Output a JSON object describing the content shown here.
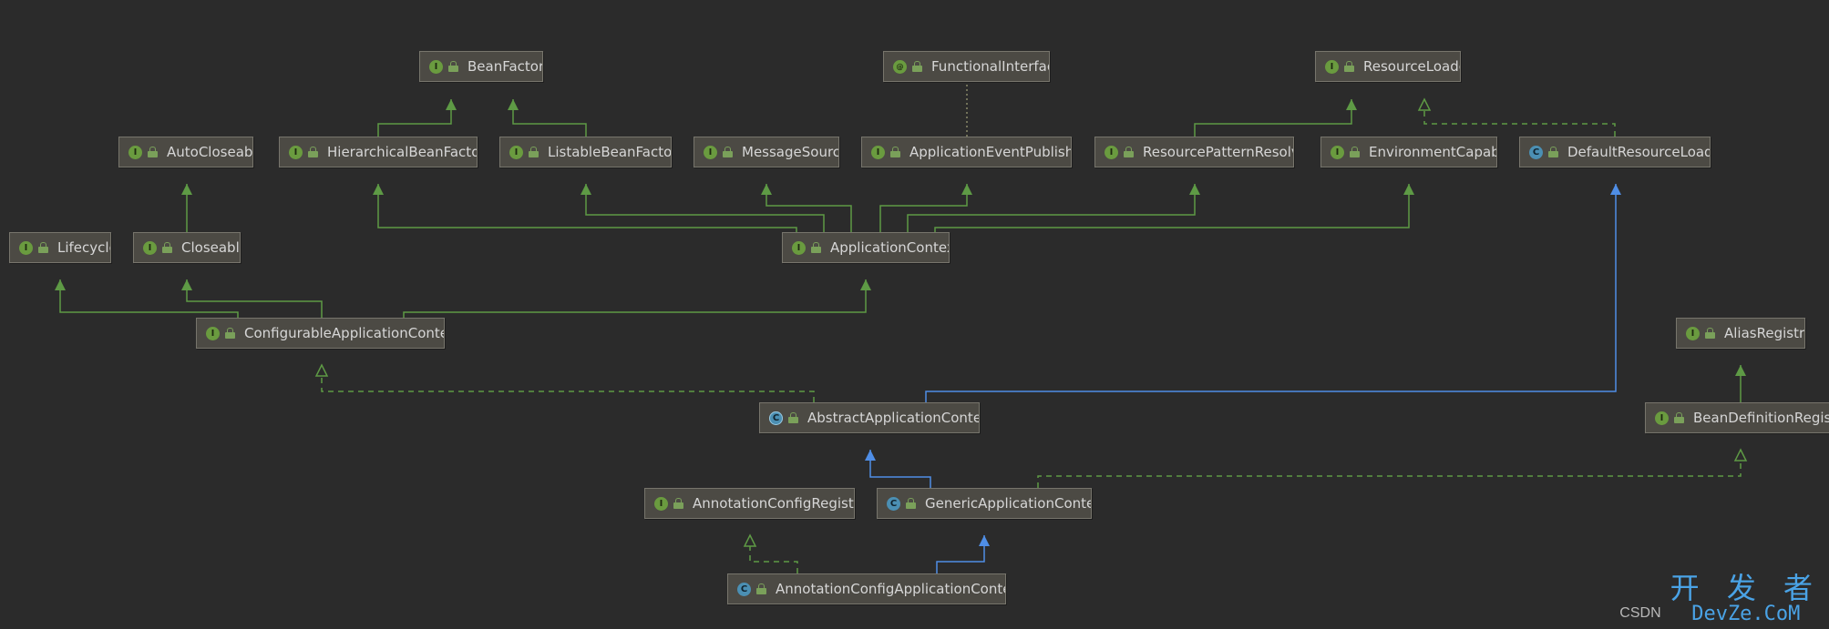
{
  "nodes": [
    {
      "id": "BeanFactory",
      "label": "BeanFactory",
      "kind": "interface"
    },
    {
      "id": "FunctionalInterface",
      "label": "FunctionalInterface",
      "kind": "annotation"
    },
    {
      "id": "ResourceLoader",
      "label": "ResourceLoader",
      "kind": "interface"
    },
    {
      "id": "AutoCloseable",
      "label": "AutoCloseable",
      "kind": "interface"
    },
    {
      "id": "HierarchicalBeanFactory",
      "label": "HierarchicalBeanFactory",
      "kind": "interface"
    },
    {
      "id": "ListableBeanFactory",
      "label": "ListableBeanFactory",
      "kind": "interface"
    },
    {
      "id": "MessageSource",
      "label": "MessageSource",
      "kind": "interface"
    },
    {
      "id": "ApplicationEventPublisher",
      "label": "ApplicationEventPublisher",
      "kind": "interface"
    },
    {
      "id": "ResourcePatternResolver",
      "label": "ResourcePatternResolver",
      "kind": "interface"
    },
    {
      "id": "EnvironmentCapable",
      "label": "EnvironmentCapable",
      "kind": "interface"
    },
    {
      "id": "DefaultResourceLoader",
      "label": "DefaultResourceLoader",
      "kind": "class"
    },
    {
      "id": "Lifecycle",
      "label": "Lifecycle",
      "kind": "interface"
    },
    {
      "id": "Closeable",
      "label": "Closeable",
      "kind": "interface"
    },
    {
      "id": "ApplicationContext",
      "label": "ApplicationContext",
      "kind": "interface"
    },
    {
      "id": "ConfigurableApplicationContext",
      "label": "ConfigurableApplicationContext",
      "kind": "interface"
    },
    {
      "id": "AliasRegistry",
      "label": "AliasRegistry",
      "kind": "interface"
    },
    {
      "id": "AbstractApplicationContext",
      "label": "AbstractApplicationContext",
      "kind": "abstract"
    },
    {
      "id": "BeanDefinitionRegistry",
      "label": "BeanDefinitionRegistr",
      "kind": "interface"
    },
    {
      "id": "AnnotationConfigRegistry",
      "label": "AnnotationConfigRegistry",
      "kind": "interface"
    },
    {
      "id": "GenericApplicationContext",
      "label": "GenericApplicationContext",
      "kind": "class"
    },
    {
      "id": "AnnotationConfigApplicationContext",
      "label": "AnnotationConfigApplicationContext",
      "kind": "class"
    }
  ],
  "edges": [
    {
      "from": "HierarchicalBeanFactory",
      "to": "BeanFactory",
      "type": "extends"
    },
    {
      "from": "ListableBeanFactory",
      "to": "BeanFactory",
      "type": "extends"
    },
    {
      "from": "ApplicationEventPublisher",
      "to": "FunctionalInterface",
      "type": "annotated"
    },
    {
      "from": "ResourcePatternResolver",
      "to": "ResourceLoader",
      "type": "extends"
    },
    {
      "from": "DefaultResourceLoader",
      "to": "ResourceLoader",
      "type": "implements"
    },
    {
      "from": "Closeable",
      "to": "AutoCloseable",
      "type": "extends"
    },
    {
      "from": "ApplicationContext",
      "to": "HierarchicalBeanFactory",
      "type": "extends"
    },
    {
      "from": "ApplicationContext",
      "to": "ListableBeanFactory",
      "type": "extends"
    },
    {
      "from": "ApplicationContext",
      "to": "MessageSource",
      "type": "extends"
    },
    {
      "from": "ApplicationContext",
      "to": "ApplicationEventPublisher",
      "type": "extends"
    },
    {
      "from": "ApplicationContext",
      "to": "ResourcePatternResolver",
      "type": "extends"
    },
    {
      "from": "ApplicationContext",
      "to": "EnvironmentCapable",
      "type": "extends"
    },
    {
      "from": "ConfigurableApplicationContext",
      "to": "Lifecycle",
      "type": "extends"
    },
    {
      "from": "ConfigurableApplicationContext",
      "to": "Closeable",
      "type": "extends"
    },
    {
      "from": "ConfigurableApplicationContext",
      "to": "ApplicationContext",
      "type": "extends"
    },
    {
      "from": "AbstractApplicationContext",
      "to": "ConfigurableApplicationContext",
      "type": "implements"
    },
    {
      "from": "AbstractApplicationContext",
      "to": "DefaultResourceLoader",
      "type": "class-extends"
    },
    {
      "from": "BeanDefinitionRegistry",
      "to": "AliasRegistry",
      "type": "extends"
    },
    {
      "from": "GenericApplicationContext",
      "to": "AbstractApplicationContext",
      "type": "class-extends"
    },
    {
      "from": "GenericApplicationContext",
      "to": "BeanDefinitionRegistry",
      "type": "implements"
    },
    {
      "from": "AnnotationConfigApplicationContext",
      "to": "AnnotationConfigRegistry",
      "type": "implements"
    },
    {
      "from": "AnnotationConfigApplicationContext",
      "to": "GenericApplicationContext",
      "type": "class-extends"
    }
  ],
  "colors": {
    "background": "#2b2b2b",
    "node_fill": "#4c4a44",
    "node_border": "#77756c",
    "node_text": "#d6d6d6",
    "interface_edge": "#5e9a45",
    "class_edge": "#4f8ee6",
    "annotation_edge": "#8a8a6a",
    "interface_badge": "#6a9b3f",
    "class_badge": "#4b8fb3",
    "watermark": "#4aa3e6"
  },
  "watermark": {
    "csdn": "CSDN",
    "cn": "开 发 者",
    "en": "DevZe.CoM"
  }
}
